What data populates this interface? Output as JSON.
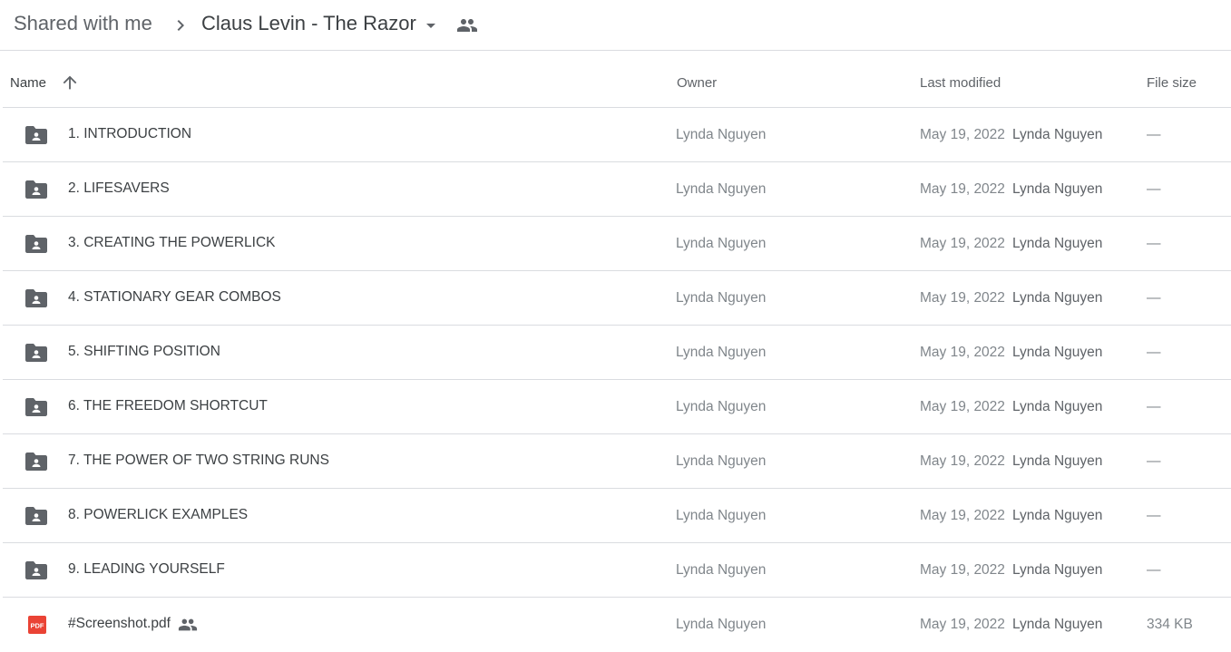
{
  "breadcrumb": {
    "root": "Shared with me",
    "current": "Claus Levin - The Razor"
  },
  "columns": {
    "name": "Name",
    "owner": "Owner",
    "last_modified": "Last modified",
    "file_size": "File size"
  },
  "colors": {
    "folder_icon": "#5f6368",
    "pdf_icon": "#ea4335",
    "divider": "#dadce0"
  },
  "rows": [
    {
      "name": "1. INTRODUCTION",
      "type": "shared-folder",
      "owner": "Lynda Nguyen",
      "date": "May 19, 2022",
      "modified_by": "Lynda Nguyen",
      "size": "—"
    },
    {
      "name": "2. LIFESAVERS",
      "type": "shared-folder",
      "owner": "Lynda Nguyen",
      "date": "May 19, 2022",
      "modified_by": "Lynda Nguyen",
      "size": "—"
    },
    {
      "name": "3. CREATING THE POWERLICK",
      "type": "shared-folder",
      "owner": "Lynda Nguyen",
      "date": "May 19, 2022",
      "modified_by": "Lynda Nguyen",
      "size": "—"
    },
    {
      "name": "4. STATIONARY GEAR COMBOS",
      "type": "shared-folder",
      "owner": "Lynda Nguyen",
      "date": "May 19, 2022",
      "modified_by": "Lynda Nguyen",
      "size": "—"
    },
    {
      "name": "5. SHIFTING POSITION",
      "type": "shared-folder",
      "owner": "Lynda Nguyen",
      "date": "May 19, 2022",
      "modified_by": "Lynda Nguyen",
      "size": "—"
    },
    {
      "name": "6. THE FREEDOM SHORTCUT",
      "type": "shared-folder",
      "owner": "Lynda Nguyen",
      "date": "May 19, 2022",
      "modified_by": "Lynda Nguyen",
      "size": "—"
    },
    {
      "name": "7. THE POWER OF TWO STRING RUNS",
      "type": "shared-folder",
      "owner": "Lynda Nguyen",
      "date": "May 19, 2022",
      "modified_by": "Lynda Nguyen",
      "size": "—"
    },
    {
      "name": "8. POWERLICK EXAMPLES",
      "type": "shared-folder",
      "owner": "Lynda Nguyen",
      "date": "May 19, 2022",
      "modified_by": "Lynda Nguyen",
      "size": "—"
    },
    {
      "name": "9. LEADING YOURSELF",
      "type": "shared-folder",
      "owner": "Lynda Nguyen",
      "date": "May 19, 2022",
      "modified_by": "Lynda Nguyen",
      "size": "—"
    },
    {
      "name": "#Screenshot.pdf",
      "type": "pdf",
      "shared": true,
      "pdf_label": "PDF",
      "owner": "Lynda Nguyen",
      "date": "May 19, 2022",
      "modified_by": "Lynda Nguyen",
      "size": "334 KB"
    }
  ]
}
